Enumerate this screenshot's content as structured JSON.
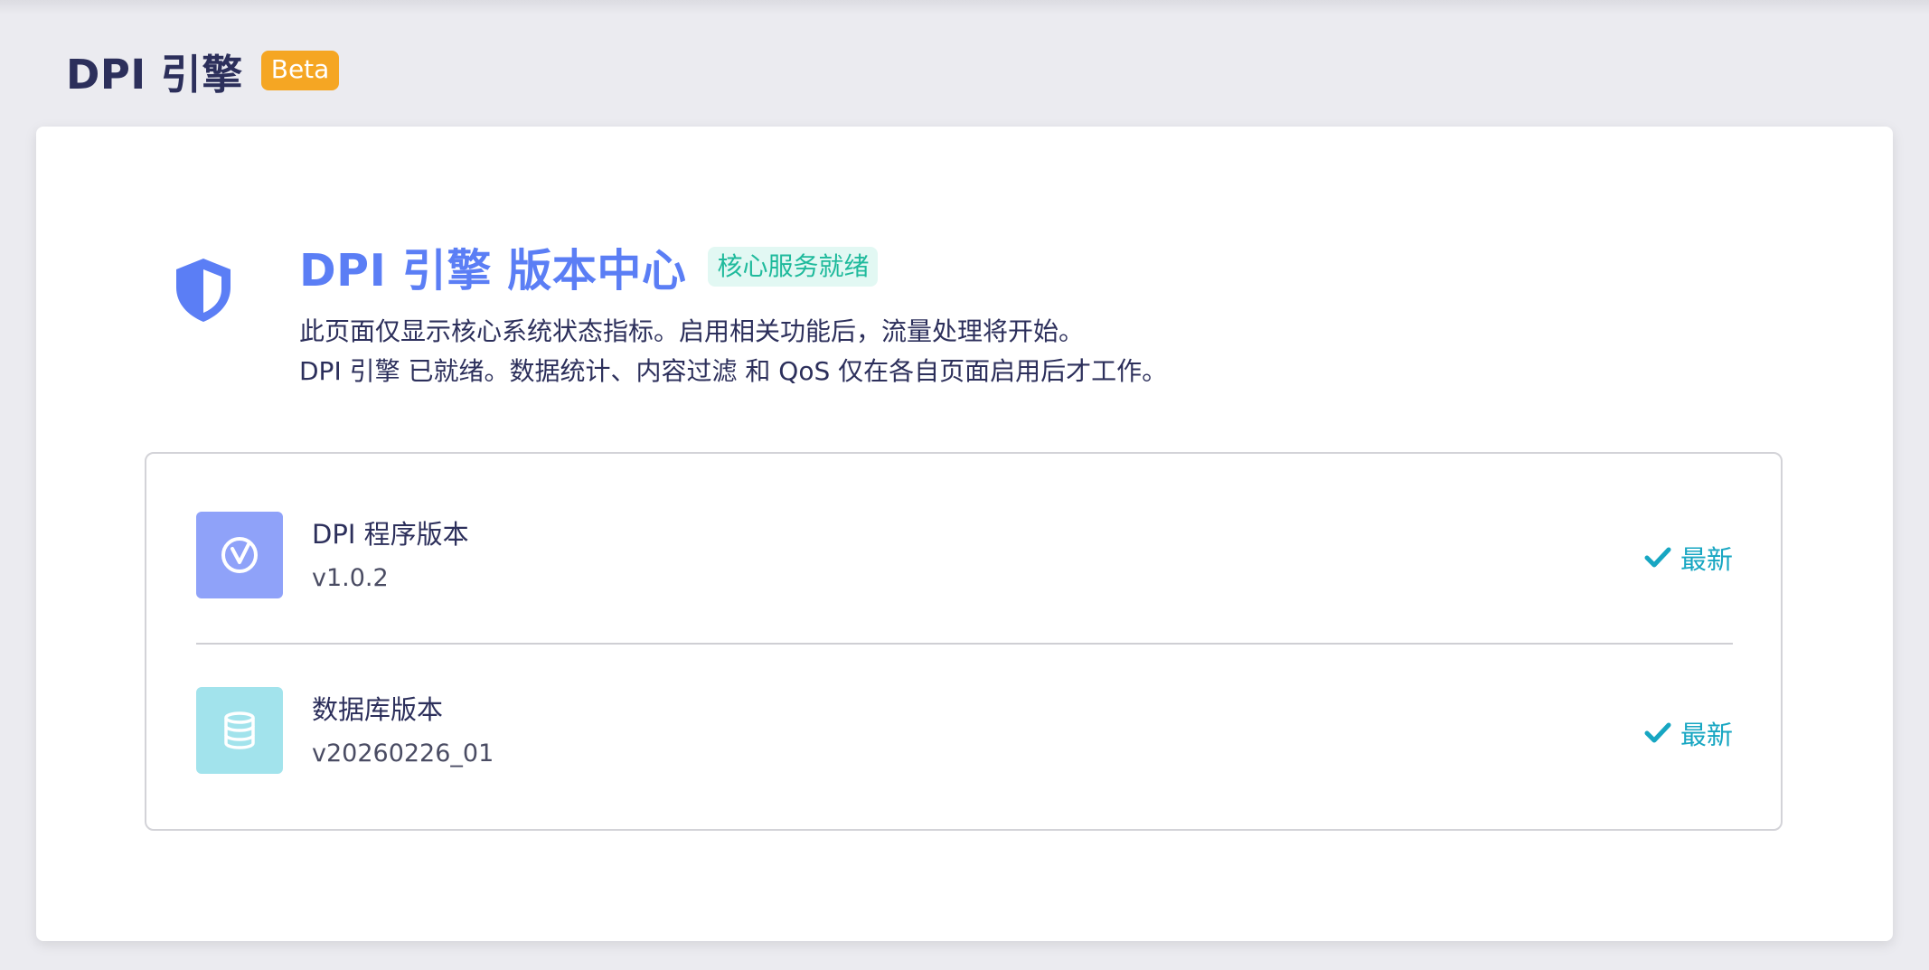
{
  "page": {
    "title": "DPI 引擎",
    "beta_badge": "Beta"
  },
  "hero": {
    "icon": "shield-icon",
    "title": "DPI 引擎 版本中心",
    "status_badge": "核心服务就绪",
    "desc_line1": "此页面仅显示核心系统状态指标。启用相关功能后，流量处理将开始。",
    "desc_line2": "DPI 引擎 已就绪。数据统计、内容过滤 和 QoS 仅在各自页面启用后才工作。"
  },
  "versions": [
    {
      "icon": "version-v-icon",
      "label": "DPI 程序版本",
      "value": "v1.0.2",
      "status": "最新"
    },
    {
      "icon": "database-icon",
      "label": "数据库版本",
      "value": "v20260226_01",
      "status": "最新"
    }
  ],
  "colors": {
    "accent": "#5b7ef5",
    "beta": "#f5a623",
    "ready_badge_text": "#1fba9c",
    "latest": "#17a6c2",
    "program_icon_bg": "#8fa2f9",
    "db_icon_bg": "#a2e3ec"
  }
}
